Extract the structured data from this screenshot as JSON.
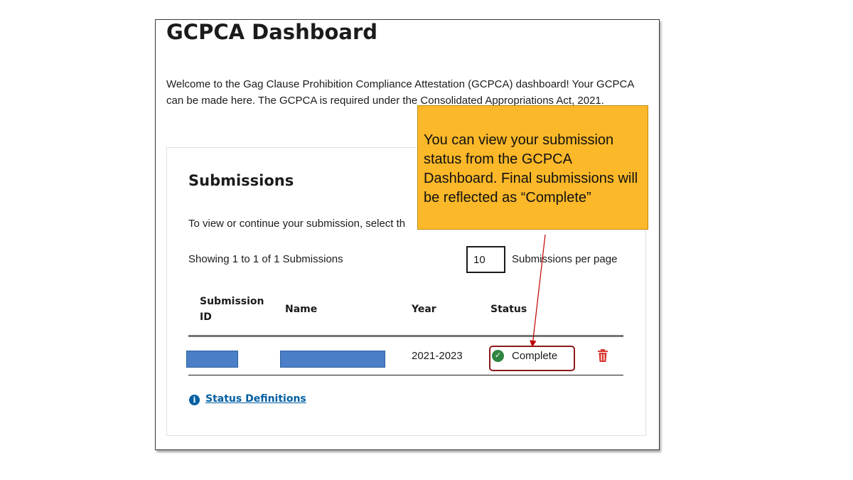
{
  "dashboard": {
    "title": "GCPCA Dashboard",
    "intro": "Welcome to the Gag Clause Prohibition Compliance Attestation (GCPCA) dashboard! Your GCPCA can be made here. The GCPCA is required under the Consolidated Appropriations Act, 2021."
  },
  "submissions": {
    "title": "Submissions",
    "instructions": "To view or continue your submission, select th",
    "showing": "Showing 1 to 1 of 1 Submissions",
    "per_page_value": "10",
    "per_page_label": "Submissions per page",
    "columns": {
      "id": "Submission ID",
      "name": "Name",
      "year": "Year",
      "status": "Status"
    },
    "rows": [
      {
        "year": "2021-2023",
        "status": "Complete",
        "status_color": "#2e8540"
      }
    ],
    "status_definitions_link": "Status Definitions"
  },
  "callout": {
    "text": "You can view your submission status from the GCPCA Dashboard.  Final submissions will be reflected as “Complete”",
    "background": "#fbb829"
  },
  "icons": {
    "status": "check-circle-icon",
    "delete": "trash-icon",
    "info": "info-icon"
  },
  "colors": {
    "link": "#005ea2",
    "delete": "#d83933",
    "highlight_border": "#8b1a1a",
    "redaction": "#4a7fc8",
    "arrow": "#c00000"
  }
}
